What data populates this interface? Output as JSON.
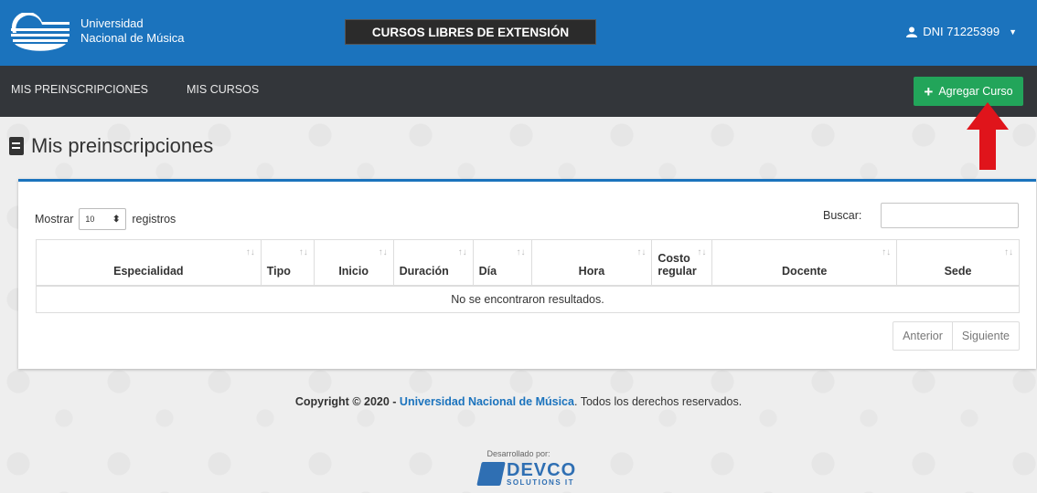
{
  "header": {
    "brand_line1": "Universidad",
    "brand_line2": "Nacional de Música",
    "title": "CURSOS LIBRES DE EXTENSIÓN",
    "user": "DNI 71225399"
  },
  "nav": {
    "items": [
      {
        "label": "MIS PREINSCRIPCIONES"
      },
      {
        "label": "MIS CURSOS"
      }
    ],
    "add_course": "Agregar Curso"
  },
  "page": {
    "title": "Mis preinscripciones"
  },
  "table_controls": {
    "show_prefix": "Mostrar",
    "page_size": "10",
    "show_suffix": "registros",
    "search_label": "Buscar:",
    "search_value": ""
  },
  "table": {
    "columns": [
      {
        "line1": "",
        "line2": "Especialidad"
      },
      {
        "line1": "",
        "line2": "Tipo"
      },
      {
        "line1": "",
        "line2": "Inicio"
      },
      {
        "line1": "",
        "line2": "Duración"
      },
      {
        "line1": "",
        "line2": "Día"
      },
      {
        "line1": "",
        "line2": "Hora"
      },
      {
        "line1": "Costo",
        "line2": "regular"
      },
      {
        "line1": "",
        "line2": "Docente"
      },
      {
        "line1": "",
        "line2": "Sede"
      }
    ],
    "empty_message": "No se encontraron resultados."
  },
  "pagination": {
    "prev": "Anterior",
    "next": "Siguiente"
  },
  "footer": {
    "copyright_prefix": "Copyright © 2020 - ",
    "copyright_link": "Universidad Nacional de Música",
    "copyright_suffix": ". Todos los derechos reservados.",
    "developed_by": "Desarrollado por:",
    "dev_name": "DEVCO",
    "dev_sub": "SOLUTIONS IT"
  },
  "colors": {
    "header_blue": "#1b73bd",
    "navbar_dark": "#33363a",
    "add_button_green": "#22a55a",
    "arrow_red": "#e0141b"
  },
  "icons": [
    "logo-icon",
    "user-icon",
    "caret-down-icon",
    "plus-icon",
    "book-icon",
    "sort-icon",
    "select-updown-icon",
    "red-arrow-icon",
    "devco-logo-icon"
  ]
}
